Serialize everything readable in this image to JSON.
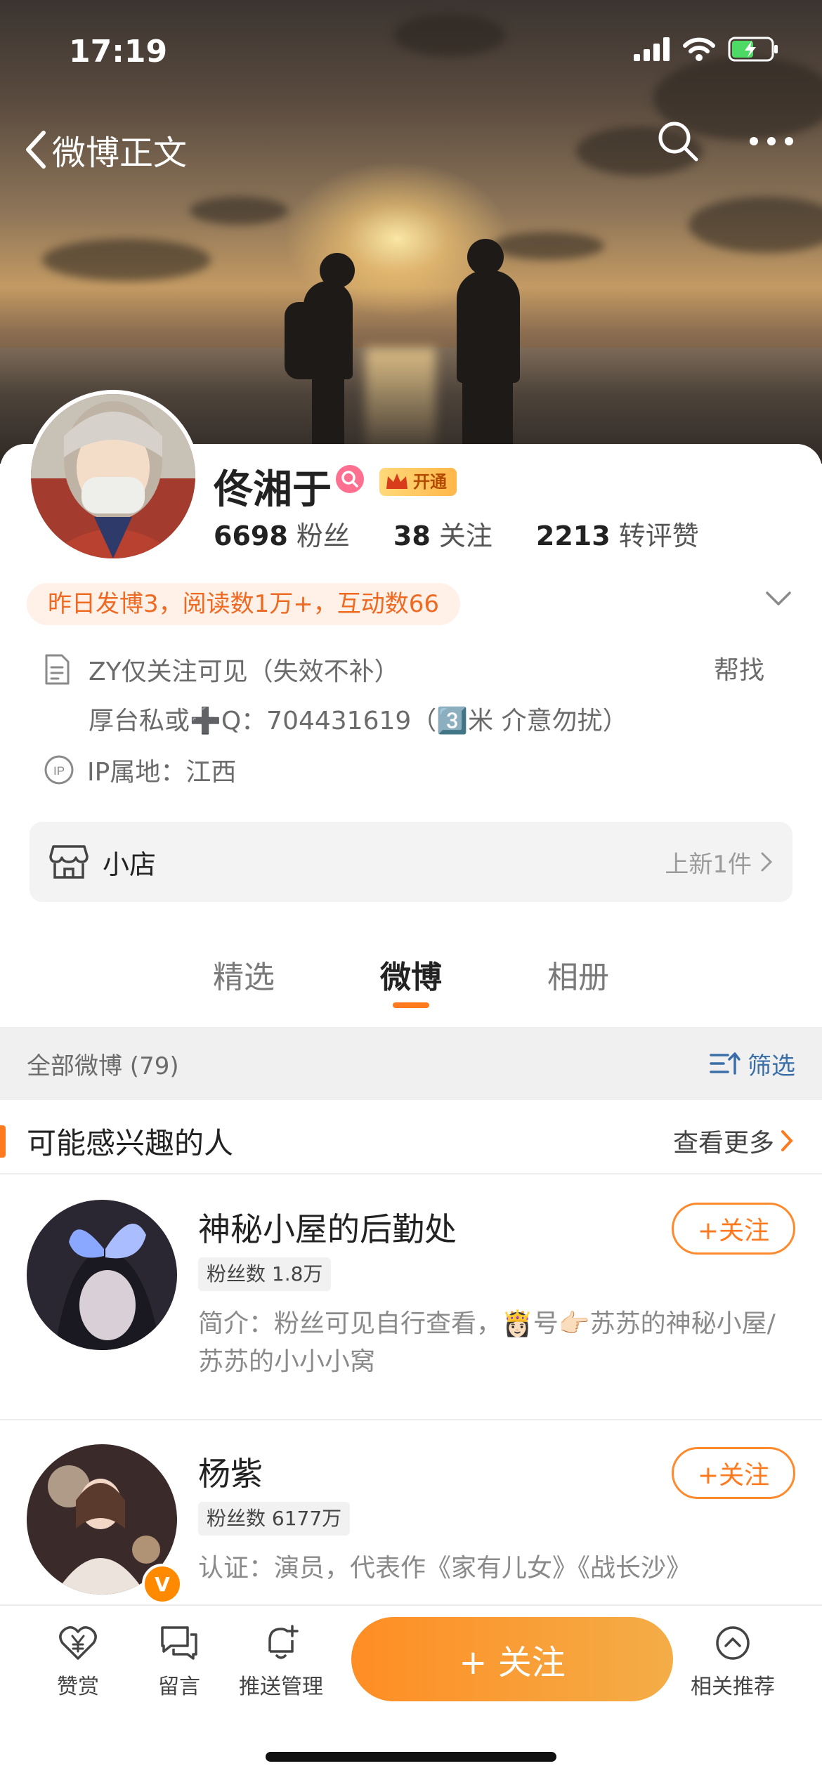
{
  "status": {
    "time": "17:19"
  },
  "nav": {
    "back_label": "微博正文"
  },
  "profile": {
    "name": "佟湘于",
    "vip_label": "开通",
    "stats": [
      {
        "num": "6698",
        "label": "粉丝"
      },
      {
        "num": "38",
        "label": "关注"
      },
      {
        "num": "2213",
        "label": "转评赞"
      }
    ],
    "activity": "昨日发博3，阅读数1万+，互动数66",
    "bio_line1": "ZY仅关注可见（失效不补）",
    "bio_line2": "厚台私或➕Q：704431619（3️⃣米 介意勿扰）",
    "bio_help": "帮找",
    "ip": "IP属地：江西"
  },
  "shop": {
    "label": "小店",
    "status": "上新1件"
  },
  "tabs": [
    {
      "label": "精选"
    },
    {
      "label": "微博"
    },
    {
      "label": "相册"
    }
  ],
  "feed": {
    "all_label": "全部微博 (79)",
    "filter_label": "筛选"
  },
  "suggest": {
    "title": "可能感兴趣的人",
    "more": "查看更多",
    "users": [
      {
        "name": "神秘小屋的后勤处",
        "fans": "粉丝数 1.8万",
        "desc": "简介：粉丝可见自行查看，👸🏻号👉🏻苏苏的神秘小屋/苏苏的小小小窝",
        "follow": "+关注"
      },
      {
        "name": "杨紫",
        "fans": "粉丝数 6177万",
        "desc": "认证：演员，代表作《家有儿女》《战长沙》",
        "follow": "+关注",
        "verified": "V"
      }
    ]
  },
  "bottom_bar": {
    "items": [
      {
        "label": "赞赏",
        "icon": "yen-heart-icon"
      },
      {
        "label": "留言",
        "icon": "message-icon"
      },
      {
        "label": "推送管理",
        "icon": "bell-plus-icon"
      },
      {
        "label": "相关推荐",
        "icon": "chevron-up-circle-icon"
      }
    ],
    "follow_label": "+ 关注"
  },
  "colors": {
    "accent": "#ff7a1f",
    "link": "#3a6ea8"
  }
}
